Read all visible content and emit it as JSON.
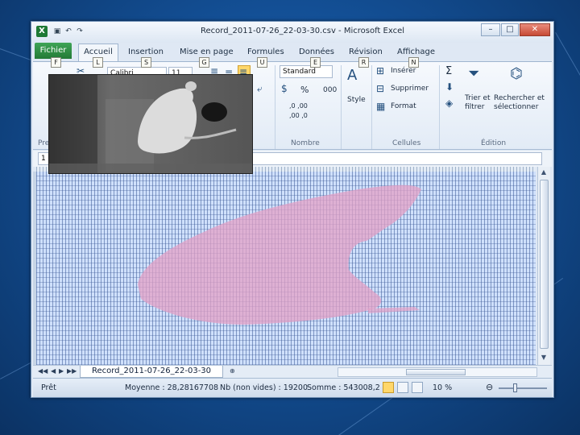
{
  "window": {
    "title": "Record_2011-07-26_22-03-30.csv - Microsoft Excel",
    "logo_letter": "X",
    "controls": [
      "–",
      "□",
      "✕"
    ]
  },
  "ribbon_tabs": [
    {
      "label": "Fichier",
      "keytip": "F"
    },
    {
      "label": "Accueil",
      "keytip": "L"
    },
    {
      "label": "Insertion",
      "keytip": "S"
    },
    {
      "label": "Mise en page",
      "keytip": "G"
    },
    {
      "label": "Formules",
      "keytip": "U"
    },
    {
      "label": "Données",
      "keytip": "E"
    },
    {
      "label": "Révision",
      "keytip": "R"
    },
    {
      "label": "Affichage",
      "keytip": "N"
    }
  ],
  "ribbon": {
    "font_name": "Calibri",
    "font_size": "11",
    "number_format": "Standard",
    "percent_symbol": "%",
    "thousands_symbol": "000",
    "inc_decimal": ",0 ,00",
    "dec_decimal": ",00 ,0",
    "style_label": "Style",
    "insert_label": "Insérer",
    "delete_label": "Supprimer",
    "format_label": "Format",
    "sum_symbol": "Σ",
    "sort_label": "Trier et filtrer",
    "find_label": "Rechercher et sélectionner",
    "groups": {
      "clipboard": "Pre",
      "number": "Nombre",
      "cells": "Cellules",
      "editing": "Édition"
    }
  },
  "formula_bar": {
    "name_box": "1"
  },
  "sheet_tab": "Record_2011-07-26_22-03-30",
  "status": {
    "ready": "Prêt",
    "average": "Moyenne : 28,28167708",
    "count": "Nb (non vides) : 19200",
    "sum": "Somme : 543008,2",
    "zoom": "10 %"
  },
  "colors": {
    "accent_green": "#237a36",
    "heatmap_blob": "#e8a5c7",
    "grid_blue": "#cfe0fb"
  },
  "icons": [
    "excel-logo-icon",
    "save-icon",
    "undo-icon",
    "redo-icon",
    "scissors-icon",
    "style-icon",
    "sum-icon",
    "sort-filter-icon",
    "binoculars-icon"
  ]
}
